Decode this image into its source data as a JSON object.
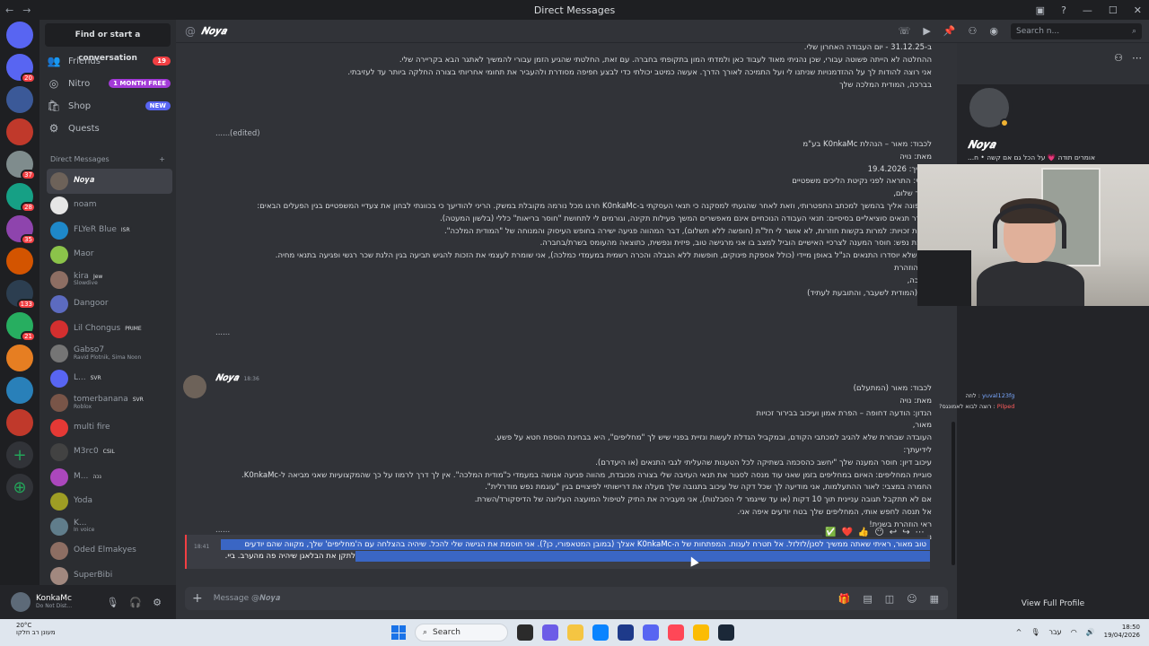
{
  "titlebar": {
    "title": "Direct Messages",
    "back": "←",
    "forward": "→"
  },
  "servers": {
    "colors": [
      "#5865f2",
      "#3b5998",
      "#c0392b",
      "#7f8c8d",
      "#16a085",
      "#8e44ad",
      "#d35400",
      "#2c3e50",
      "#27ae60",
      "#e67e22",
      "#2980b9",
      "#c0392b"
    ],
    "badges": [
      "20",
      "",
      "",
      "37",
      "28",
      "35",
      "",
      "133",
      "21",
      "",
      "",
      ""
    ],
    "add_label": "+",
    "discover_label": "⊕"
  },
  "dm_panel": {
    "find_label": "Find or start a conversation",
    "nav": [
      {
        "label": "Friends",
        "icon": "friends-icon",
        "pill": "19"
      },
      {
        "label": "Nitro",
        "icon": "nitro-icon",
        "pill": "1 MONTH FREE"
      },
      {
        "label": "Shop",
        "icon": "shop-icon",
        "pill": "NEW"
      },
      {
        "label": "Quests",
        "icon": "quests-icon",
        "pill": ""
      }
    ],
    "section_label": "Direct Messages",
    "add_dm": "+",
    "dms": [
      {
        "name": "𝑵𝒐𝒚𝒂",
        "sub": "",
        "tag": "",
        "color": "#6d6259",
        "active": true
      },
      {
        "name": "noam",
        "sub": "",
        "tag": "",
        "color": "#e6e6e6",
        "active": false
      },
      {
        "name": "FLYeR Blue",
        "sub": "",
        "tag": "ISR",
        "color": "#1e88c9",
        "active": false
      },
      {
        "name": "Maor",
        "sub": "",
        "tag": "",
        "color": "#8bc34a",
        "active": false
      },
      {
        "name": "kira",
        "sub": "Slowdive",
        "tag": "Jew",
        "color": "#8d6e63",
        "active": false
      },
      {
        "name": "Dangoor",
        "sub": "",
        "tag": "",
        "color": "#5c6bc0",
        "active": false
      },
      {
        "name": "Lil Chongus",
        "sub": "",
        "tag": "PRIME",
        "color": "#d32f2f",
        "active": false
      },
      {
        "name": "Gabso7",
        "sub": "Ravid Plotnik, Sima Noon",
        "tag": "",
        "color": "#757575",
        "active": false
      },
      {
        "name": "L...",
        "sub": "",
        "tag": "SVR",
        "color": "#5865f2",
        "active": false
      },
      {
        "name": "tomerbanana",
        "sub": "Roblox",
        "tag": "SVR",
        "color": "#795548",
        "active": false
      },
      {
        "name": "multi fire",
        "sub": "",
        "tag": "",
        "color": "#e53935",
        "active": false
      },
      {
        "name": "M3rc0",
        "sub": "",
        "tag": "CSIL",
        "color": "#424242",
        "active": false
      },
      {
        "name": "M...",
        "sub": "",
        "tag": "נכה",
        "color": "#ab47bc",
        "active": false
      },
      {
        "name": "Yoda",
        "sub": "",
        "tag": "",
        "color": "#9e9d24",
        "active": false
      },
      {
        "name": "K...",
        "sub": "In voice",
        "tag": "",
        "color": "#607d8b",
        "active": false
      },
      {
        "name": "Oded Elmakyes",
        "sub": "",
        "tag": "",
        "color": "#8d6e63",
        "active": false
      },
      {
        "name": "SuperBibi",
        "sub": "",
        "tag": "",
        "color": "#a1887f",
        "active": false
      }
    ]
  },
  "user": {
    "name": "KonkaMc",
    "status": "Do Not Dist...",
    "mic": "🎙",
    "headset": "🎧",
    "settings": "⚙"
  },
  "chat": {
    "header_name": "𝑵𝒐𝒚𝒂",
    "at": "@",
    "search_placeholder": "Search n...",
    "lines_top": [
      "ב-31.12.25 - יום העבודה האחרון שלי.",
      "ההחלטה לא הייתה פשוטה עבורי, שכן נהניתי מאוד לעבוד כאן ולמדתי המון בתקופתי בחברה. עם זאת, החלטתי שהגיע הזמן עבורי להמשיך לאתגר הבא בקריירה שלי.",
      "אני רוצה להודות לך על ההזדמנויות שניתנו לי ועל התמיכה לאורך הדרך. אעשה כמיטב יכולתי כדי לבצע חפיפה מסודרת ולהעביר את תחומי אחריותי בצורה החלקה ביותר עד לעזיבתי.",
      "בברכה, המודית המלכה שלך"
    ],
    "edited": "(edited)",
    "dots": "......",
    "block2": [
      "לכבוד: מאור – הנהלת K0nkaMc בע\"מ",
      "מאת: נויה",
      "תאריך: 19.4.2026",
      "דחוף: התראה לפני נקיטת הליכים משפטיים",
      "מאור שלום,",
      "אני פונה אליך בהמשך למכתב התפטרותי, וזאת לאחר שהגעתי למסקנה כי תנאי העסקתי ב-K0nkaMc חרגו מכל נורמה מקובלת במשק. הריני להודיעך כי בכוונתי לבחון את צעדיי המשפטיים בגין הפעלים הבאים:",
      "היעדר תנאים סוציאליים בסיסיים: תנאי העבודה הנוכחיים אינם מאפשרים המשך פעילות תקינה, וגורמים לי לתחושת \"חוסר בריאות\" כללי (בלשון המעטה).",
      "מניעת זכויות: למרות בקשות חוזרות, לא אושר לי חל\"ת (חופשה ללא תשלום), דבר המהווה פגיעה ישירה בחופש העיסוק והמנוחה של \"המודית המלכה\".",
      "עוגמת נפש: חוסר המענה לצרכיי האישיים הוביל למצב בו אני מרגישה טוב, פיזית ונפשית, כתוצאה מהעומס בשרת/בחברה.",
      "ככל שלא יוסדרו התנאים הנ\"ל באופן מיידי (כולל אספקת פינוקים, חופשות ללא הגבלה והכרה רשמית במעמדי כמלכה), אני שומרת לעצמי את הזכות להגיש תביעה בגין הלנת שכר רגשי ופגיעה בתנאי מחיה.",
      "ראי הוזהרת",
      "בברכה,",
      "נויה (המודית לשעבר, והתובעת לעתיד)"
    ],
    "msg_author": "𝑵𝒐𝒚𝒂",
    "msg_time": "18:36",
    "block3": [
      "לכבוד: מאור (המתעלם)",
      "מאת: נויה",
      "הנדון: הודעה דחופה – הפרת אמון ועיכוב בבירור זכויות",
      "מאור,",
      "העובדה שבחרת שלא להגיב למכתבי הקודם, ובמקביל הגדלת לעשות ונזיית בפניי שיש לך \"מחליפים\", היא בבחינת הוספת חטא על פשע.",
      "לידיעתך:",
      "עיכוב דיון: חוסר המענה שלך \"יחשב כהסכמה בשתיקה לכל הטענות שהעליתי לגבי התנאים (או היעדרם).",
      "סוגיית המחליפים: האיום במחליפים בזמן שאני עוד מנסה לסגור את תנאי העזיבה שלי בצורה מכובדת, מהווה פגיעה אנושה במעמדי כ\"מודית המלכה\". אין לך דרך לרמוז על כך שהמקצועיות שאני מביאה ל-K0nkaMc.",
      "החמרה במצבי: לאור ההתעלמות, אני מודיעה לך שכל דקה של עיכוב בתגובה שלך מעלה את דרישותיי לפיצויים בגין \"עוגמת נפש מודרלית\".",
      "אם לא תתקבל תגובה עניינית תוך 10 דקות (או עד שייגמר לי הסבלנות), אני מעבירה את התיק לטיפול המועצה העליונה של הדיסקורד/השרת.",
      "אל תנסה לחפש אותי, המחליפים שלך בטח יודעים איפה אני.",
      "ראי הוזהרת בשנית!",
      "נויה."
    ],
    "highlight_time": "18:41",
    "highlight_lines": [
      "טוב מאור, ראיתי שאתה ממשיך לסנן/לזלזל. אל תטרח לענות. המפתחות של ה-K0nkaMc אצלך (במובן המטאפורי, כן?). אני חוסמת את הגישה שלי להכל. שיהיה בהצלחה עם ה'מחליפים' שלך, מקווה שהם יודעים",
      "לתקן את הבלאגן שיהיה פה מהערב. ביי."
    ],
    "reactions": [
      "✅",
      "❤️",
      "👍",
      "😶",
      "↩",
      "↪",
      "⋯"
    ],
    "composer_placeholder": "Message @𝑵𝒐𝒚𝒂",
    "composer_plus": "+"
  },
  "profile": {
    "name": "𝑵𝒐𝒚𝒂",
    "bio": "אומרים תודה 💗 על הכל גם אם קשה • ח...",
    "view_full": "View Full Profile"
  },
  "overlay": {
    "line1_user": "yuval123fg",
    "line1_text": "לוזה",
    "line2_user": "Pilped",
    "line2_text": "רוצה לבוא לאמונגס?"
  },
  "taskbar": {
    "weather_temp": "20°C",
    "weather_desc": "מעונן רב חלקו",
    "search_label": "Search",
    "lang": "עבר",
    "time": "18:50",
    "date": "19/04/2026"
  }
}
